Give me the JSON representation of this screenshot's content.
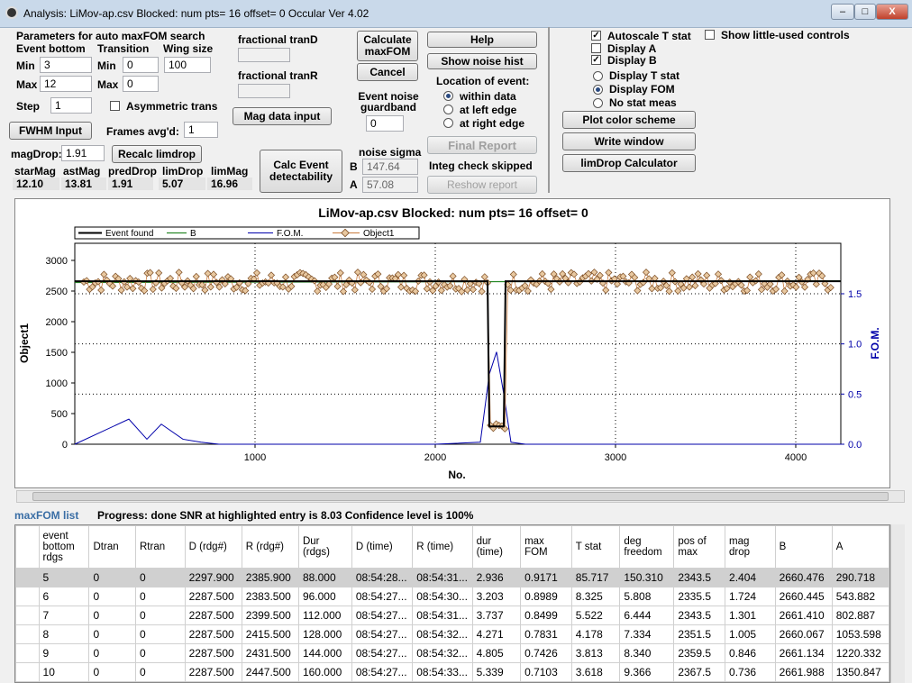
{
  "window": {
    "title": "Analysis: LiMov-ap.csv Blocked: num pts= 16 offset= 0  Occular Ver 4.02",
    "minimize": "–",
    "maximize": "□",
    "close": "X"
  },
  "params": {
    "group_title": "Parameters for auto maxFOM search",
    "event_bottom": "Event bottom",
    "transition": "Transition",
    "wing_size": "Wing size",
    "min_label": "Min",
    "max_label": "Max",
    "step_label": "Step",
    "min_value": "3",
    "max_value": "12",
    "trans_min_value": "0",
    "trans_max_value": "0",
    "wing_value": "100",
    "step_value": "1",
    "asym_label": "Asymmetric trans",
    "fwhm_button": "FWHM Input",
    "frames_label": "Frames avg'd:",
    "frames_value": "1",
    "magdrop_label": "magDrop:",
    "magdrop_value": "1.91",
    "recalc_button": "Recalc limdrop"
  },
  "stats": {
    "headers": [
      "starMag",
      "astMag",
      "predDrop",
      "limDrop",
      "limMag"
    ],
    "values": [
      "12.10",
      "13.81",
      "1.91",
      "5.07",
      "16.96"
    ]
  },
  "fractional": {
    "tranD": "fractional tranD",
    "tranR": "fractional tranR",
    "mag_data_button": "Mag data input"
  },
  "calc": {
    "calc_button": "Calculate maxFOM",
    "cancel_button": "Cancel",
    "noise_guard_label": "Event noise guardband",
    "noise_guard_value": "0",
    "detect_button": "Calc Event detectability",
    "noise_sigma_label": "noise sigma",
    "b_label": "B",
    "a_label": "A",
    "b_value": "147.64",
    "a_value": "57.08"
  },
  "location": {
    "help_button": "Help",
    "noise_hist_button": "Show noise hist",
    "title": "Location of event:",
    "options": [
      "within data",
      "at left edge",
      "at right edge"
    ],
    "final_report_button": "Final Report",
    "integ_label": "Integ check skipped",
    "reshow_button": "Reshow report"
  },
  "display": {
    "autoscale": "Autoscale T stat",
    "display_a": "Display A",
    "display_b": "Display B",
    "little_used": "Show little-used controls",
    "radio": [
      "Display T stat",
      "Display FOM",
      "No stat meas"
    ],
    "plot_color_button": "Plot color scheme",
    "write_window_button": "Write window",
    "limdrop_calc_button": "limDrop Calculator"
  },
  "chart_data": {
    "type": "line",
    "title": "LiMov-ap.csv Blocked: num pts= 16 offset= 0",
    "xlabel": "No.",
    "ylabel": "Object1",
    "y2label": "F.O.M.",
    "xlim": [
      0,
      4250
    ],
    "ylim": [
      0,
      3000
    ],
    "y2lim": [
      0,
      1.5
    ],
    "xticks": [
      1000,
      2000,
      3000,
      4000
    ],
    "yticks": [
      0,
      500,
      1000,
      1500,
      2000,
      2500,
      3000
    ],
    "y2ticks": [
      0.0,
      0.5,
      1.0,
      1.5
    ],
    "grid": "dotted",
    "legend": "top-left",
    "series": [
      {
        "name": "Event found",
        "color": "#000000",
        "x": [
          0,
          2290,
          2300,
          2380,
          2390,
          4250
        ],
        "y": [
          2660,
          2660,
          290,
          290,
          2660,
          2660
        ]
      },
      {
        "name": "B",
        "color": "#2a8a2a",
        "x": [
          0,
          4250
        ],
        "y": [
          2640,
          2665
        ]
      },
      {
        "name": "F.O.M.",
        "color": "#0000aa",
        "x": [
          0,
          300,
          400,
          480,
          600,
          700,
          800,
          1000,
          2000,
          2250,
          2300,
          2340,
          2380,
          2420,
          2500,
          4250
        ],
        "y": [
          0,
          0.25,
          0.05,
          0.2,
          0.05,
          0.02,
          0,
          0,
          0,
          0.02,
          0.7,
          0.92,
          0.5,
          0.02,
          0,
          0
        ]
      },
      {
        "name": "Object1",
        "color": "#c87a3c",
        "x": [
          50,
          2300,
          2320,
          2340,
          2360,
          2380,
          2400,
          4200
        ],
        "y": [
          2650,
          2600,
          300,
          250,
          280,
          260,
          2600,
          2650
        ]
      }
    ]
  },
  "progress": {
    "list_label": "maxFOM list",
    "status": "Progress: done  SNR at highlighted entry is 8.03   Confidence level is  100%"
  },
  "table": {
    "columns": [
      "event bottom rdgs",
      "Dtran",
      "Rtran",
      "D (rdg#)",
      "R (rdg#)",
      "Dur (rdgs)",
      "D (time)",
      "R (time)",
      "dur (time)",
      "max FOM",
      "T stat",
      "deg freedom",
      "pos of max",
      "mag drop",
      "B",
      "A"
    ],
    "rows": [
      [
        "5",
        "0",
        "0",
        "2297.900",
        "2385.900",
        "88.000",
        "08:54:28...",
        "08:54:31...",
        "2.936",
        "0.9171",
        "85.717",
        "150.310",
        "2343.5",
        "2.404",
        "2660.476",
        "290.718"
      ],
      [
        "6",
        "0",
        "0",
        "2287.500",
        "2383.500",
        "96.000",
        "08:54:27...",
        "08:54:30...",
        "3.203",
        "0.8989",
        "8.325",
        "5.808",
        "2335.5",
        "1.724",
        "2660.445",
        "543.882"
      ],
      [
        "7",
        "0",
        "0",
        "2287.500",
        "2399.500",
        "112.000",
        "08:54:27...",
        "08:54:31...",
        "3.737",
        "0.8499",
        "5.522",
        "6.444",
        "2343.5",
        "1.301",
        "2661.410",
        "802.887"
      ],
      [
        "8",
        "0",
        "0",
        "2287.500",
        "2415.500",
        "128.000",
        "08:54:27...",
        "08:54:32...",
        "4.271",
        "0.7831",
        "4.178",
        "7.334",
        "2351.5",
        "1.005",
        "2660.067",
        "1053.598"
      ],
      [
        "9",
        "0",
        "0",
        "2287.500",
        "2431.500",
        "144.000",
        "08:54:27...",
        "08:54:32...",
        "4.805",
        "0.7426",
        "3.813",
        "8.340",
        "2359.5",
        "0.846",
        "2661.134",
        "1220.332"
      ],
      [
        "10",
        "0",
        "0",
        "2287.500",
        "2447.500",
        "160.000",
        "08:54:27...",
        "08:54:33...",
        "5.339",
        "0.7103",
        "3.618",
        "9.366",
        "2367.5",
        "0.736",
        "2661.988",
        "1350.847"
      ]
    ]
  }
}
